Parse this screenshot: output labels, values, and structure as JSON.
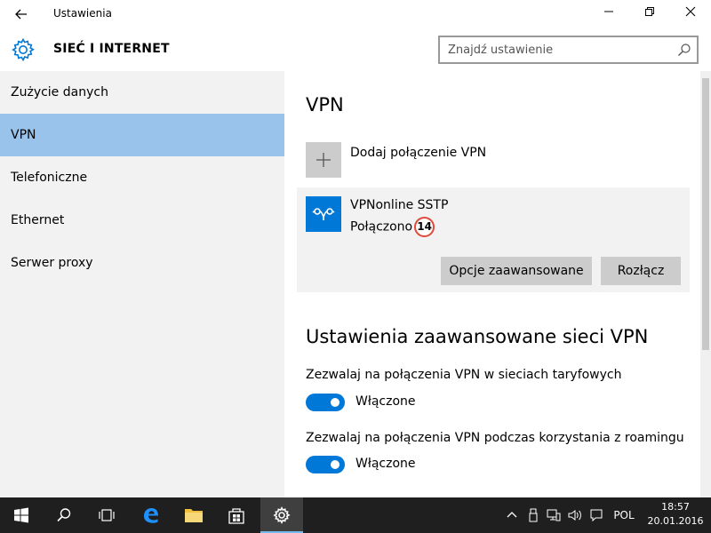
{
  "window": {
    "title": "Ustawienia"
  },
  "header": {
    "section_title": "SIEĆ I INTERNET",
    "search_placeholder": "Znajdź ustawienie"
  },
  "sidebar": {
    "items": [
      {
        "label": "Zużycie danych",
        "active": false
      },
      {
        "label": "VPN",
        "active": true
      },
      {
        "label": "Telefoniczne",
        "active": false
      },
      {
        "label": "Ethernet",
        "active": false
      },
      {
        "label": "Serwer proxy",
        "active": false
      }
    ]
  },
  "main": {
    "title": "VPN",
    "add_connection_label": "Dodaj połączenie VPN",
    "vpn": {
      "name": "VPNonline SSTP",
      "status": "Połączono",
      "badge": "14",
      "advanced_button": "Opcje zaawansowane",
      "disconnect_button": "Rozłącz"
    },
    "advanced_title": "Ustawienia zaawansowane sieci VPN",
    "options": [
      {
        "label": "Zezwalaj na połączenia VPN w sieciach taryfowych",
        "state": "Włączone"
      },
      {
        "label": "Zezwalaj na połączenia VPN podczas korzystania z roamingu",
        "state": "Włączone"
      }
    ]
  },
  "taskbar": {
    "language": "POL",
    "time": "18:57",
    "date": "20.01.2016"
  },
  "colors": {
    "accent": "#0078d7",
    "selected": "#99c3ea",
    "sidebar_bg": "#f2f2f2",
    "taskbar_bg": "#1f1f1f"
  }
}
